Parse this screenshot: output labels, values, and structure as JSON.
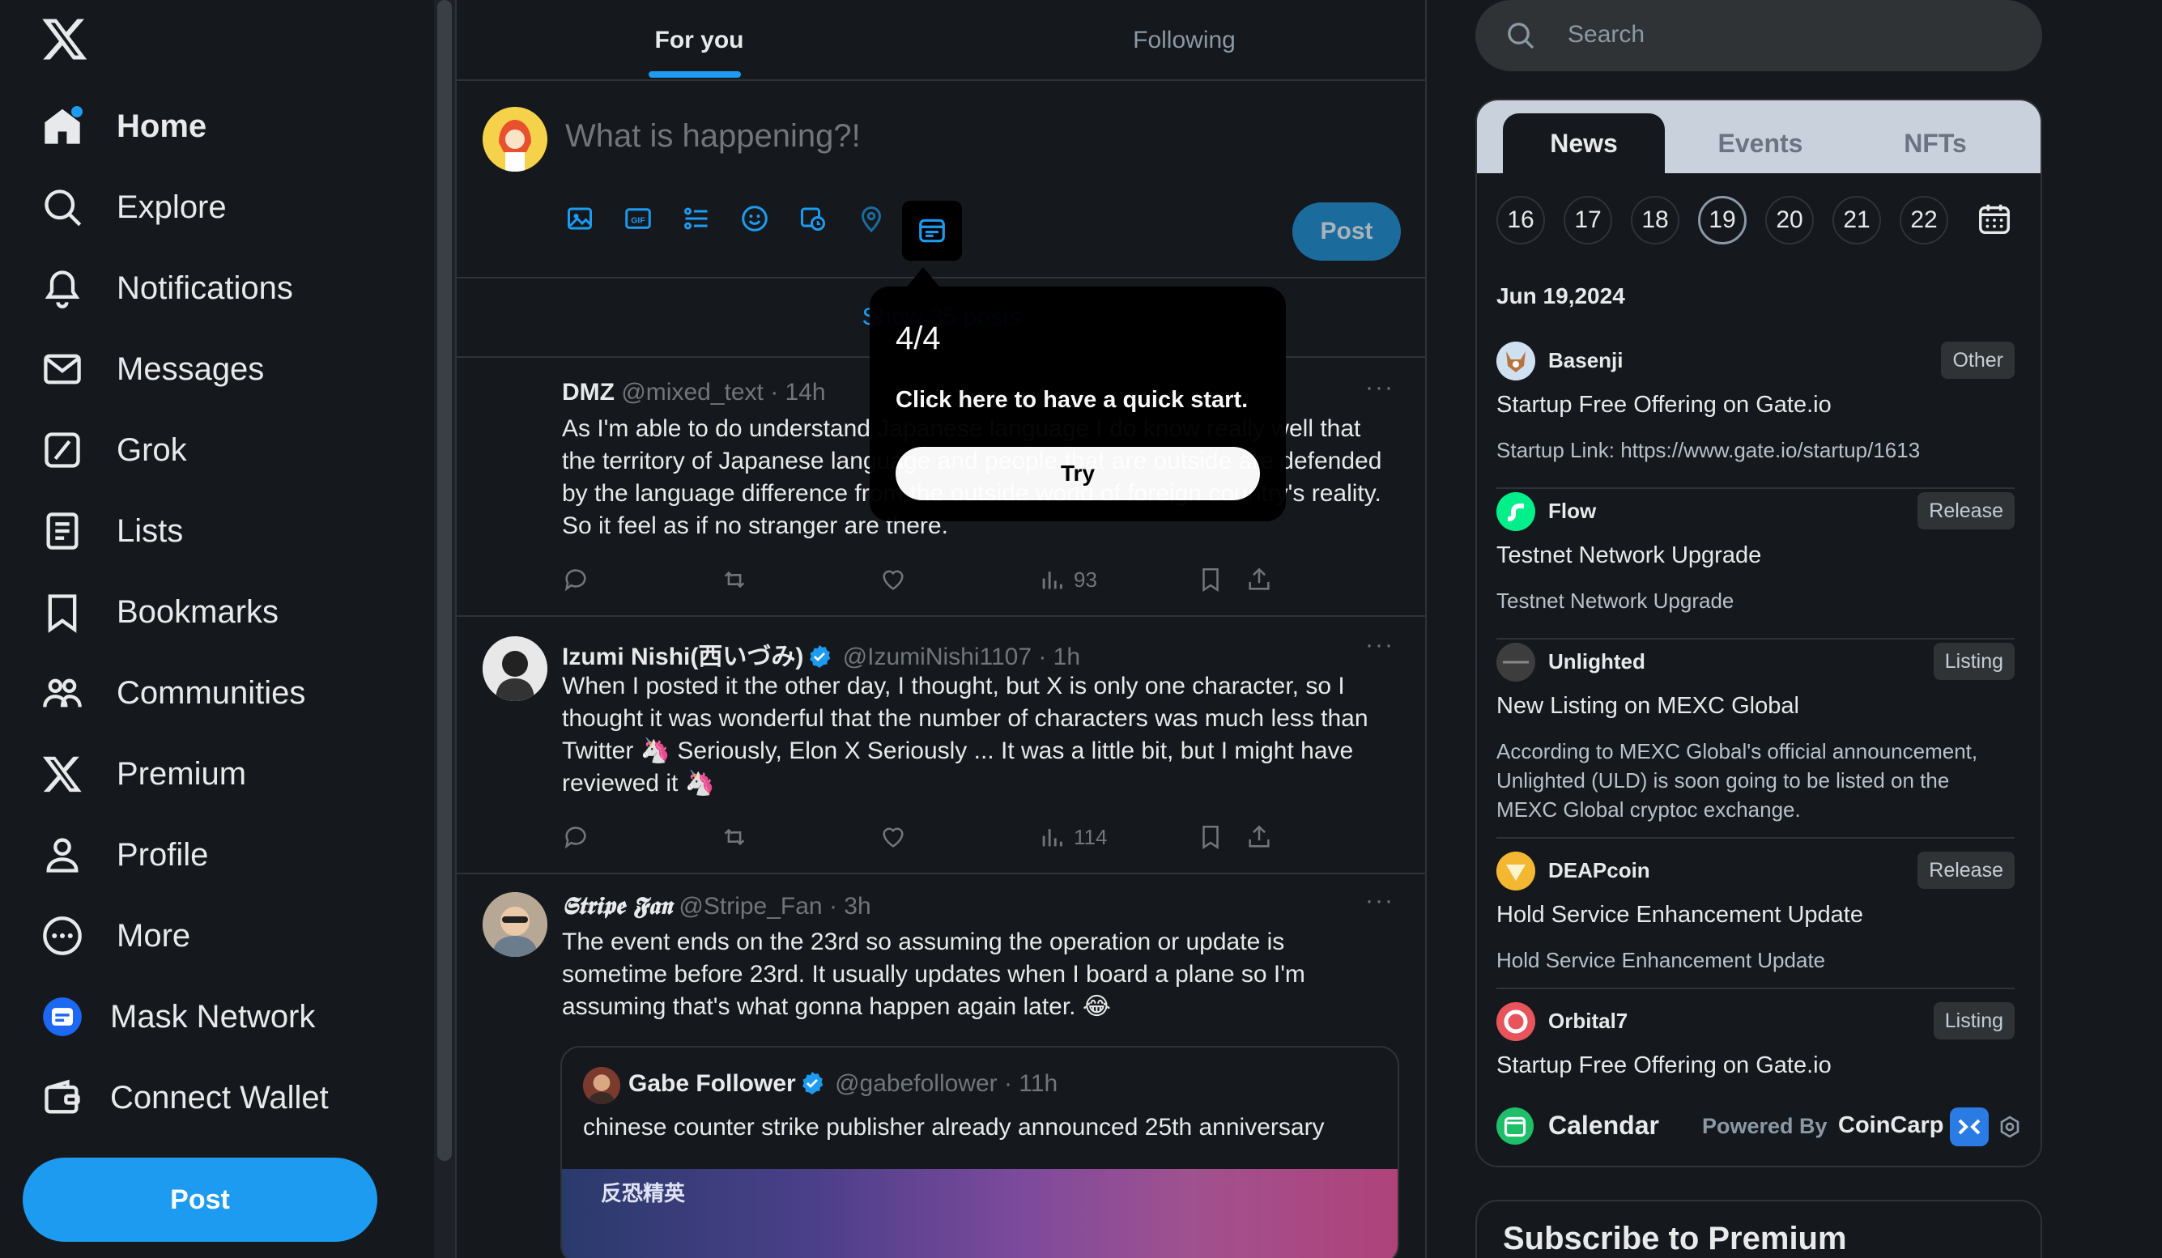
{
  "nav": {
    "items": [
      {
        "label": "Home",
        "icon": "home-icon"
      },
      {
        "label": "Explore",
        "icon": "search-icon"
      },
      {
        "label": "Notifications",
        "icon": "bell-icon"
      },
      {
        "label": "Messages",
        "icon": "envelope-icon"
      },
      {
        "label": "Grok",
        "icon": "grok-icon"
      },
      {
        "label": "Lists",
        "icon": "list-icon"
      },
      {
        "label": "Bookmarks",
        "icon": "bookmark-icon"
      },
      {
        "label": "Communities",
        "icon": "communities-icon"
      },
      {
        "label": "Premium",
        "icon": "x-logo-icon"
      },
      {
        "label": "Profile",
        "icon": "person-icon"
      },
      {
        "label": "More",
        "icon": "more-circle-icon"
      },
      {
        "label": "Mask Network",
        "icon": "mask-network-icon"
      },
      {
        "label": "Connect Wallet",
        "icon": "wallet-icon"
      }
    ],
    "post_label": "Post"
  },
  "feed": {
    "tabs": [
      {
        "label": "For you",
        "selected": true
      },
      {
        "label": "Following",
        "selected": false
      }
    ],
    "composer": {
      "placeholder": "What is happening?!",
      "post_label": "Post",
      "tools": [
        "image-icon",
        "gif-icon",
        "poll-icon",
        "emoji-icon",
        "schedule-icon",
        "location-icon",
        "mask-calendar-icon"
      ]
    },
    "show_posts": "Show 35 posts",
    "tweets": [
      {
        "name": "DMZ",
        "handle": "@mixed_text",
        "time": "· 14h",
        "verified": false,
        "text": "As I'm able to do understand Japanese language I do know really well that the territory of Japanese language and people that are outside are defended by the language difference from the outside world of foreign country's reality. So it feel as if no stranger are there.",
        "views": "93"
      },
      {
        "name": "Izumi Nishi(西いづみ)",
        "handle": "@IzumiNishi1107",
        "time": "· 1h",
        "verified": true,
        "text": "When I posted it the other day, I thought, but X is only one character, so I thought it was wonderful that the number of characters was much less than Twitter 🦄 Seriously, Elon X Seriously ... It was a little bit, but I might have reviewed it 🦄",
        "views": "114"
      },
      {
        "name": "𝕾𝖙𝖗𝖎𝖕𝖊 𝕱𝖆𝖓",
        "handle": "@Stripe_Fan",
        "time": "· 3h",
        "verified": false,
        "text": "The event ends on the 23rd so assuming the operation or update is sometime before 23rd. It usually updates when I board a plane so I'm assuming that's what gonna happen again later. 😂",
        "quote": {
          "name": "Gabe Follower",
          "handle": "@gabefollower",
          "time": "· 11h",
          "text": "chinese counter strike publisher already announced 25th anniversary",
          "image_text": "反恐精英"
        }
      }
    ]
  },
  "tooltip": {
    "step": "4/4",
    "text": "Click here to have a quick start.",
    "button": "Try"
  },
  "search": {
    "placeholder": "Search"
  },
  "calendar": {
    "tabs": [
      {
        "label": "News",
        "selected": true
      },
      {
        "label": "Events",
        "selected": false
      },
      {
        "label": "NFTs",
        "selected": false
      }
    ],
    "days": [
      "16",
      "17",
      "18",
      "19",
      "20",
      "21",
      "22"
    ],
    "selected_day": "19",
    "date": "Jun 19,2024",
    "events": [
      {
        "name": "Basenji",
        "tag": "Other",
        "title": "Startup Free Offering on Gate.io",
        "desc": "Startup Link: https://www.gate.io/startup/1613",
        "logo_color": "#d9e6f2"
      },
      {
        "name": "Flow",
        "tag": "Release",
        "title": "Testnet Network Upgrade",
        "desc": "Testnet Network Upgrade",
        "logo_color": "#00ef8b"
      },
      {
        "name": "Unlighted",
        "tag": "Listing",
        "title": "New Listing on MEXC Global",
        "desc": "According to MEXC Global's official announcement, Unlighted (ULD) is soon going to be listed on the MEXC Global cryptoc exchange.",
        "logo_color": "#3a3a3a"
      },
      {
        "name": "DEAPcoin",
        "tag": "Release",
        "title": "Hold Service Enhancement Update",
        "desc": "Hold Service Enhancement Update",
        "logo_color": "#f4b731"
      },
      {
        "name": "Orbital7",
        "tag": "Listing",
        "title": "Startup Free Offering on Gate.io",
        "desc": "",
        "logo_color": "#ee6a3c"
      }
    ],
    "footer": {
      "label": "Calendar",
      "powered": "Powered By",
      "brand": "CoinCarp"
    }
  },
  "premium": {
    "title": "Subscribe to Premium"
  },
  "colors": {
    "accent": "#1d9bf0",
    "background": "#15181c",
    "border": "#2f3336",
    "muted": "#71767b"
  }
}
